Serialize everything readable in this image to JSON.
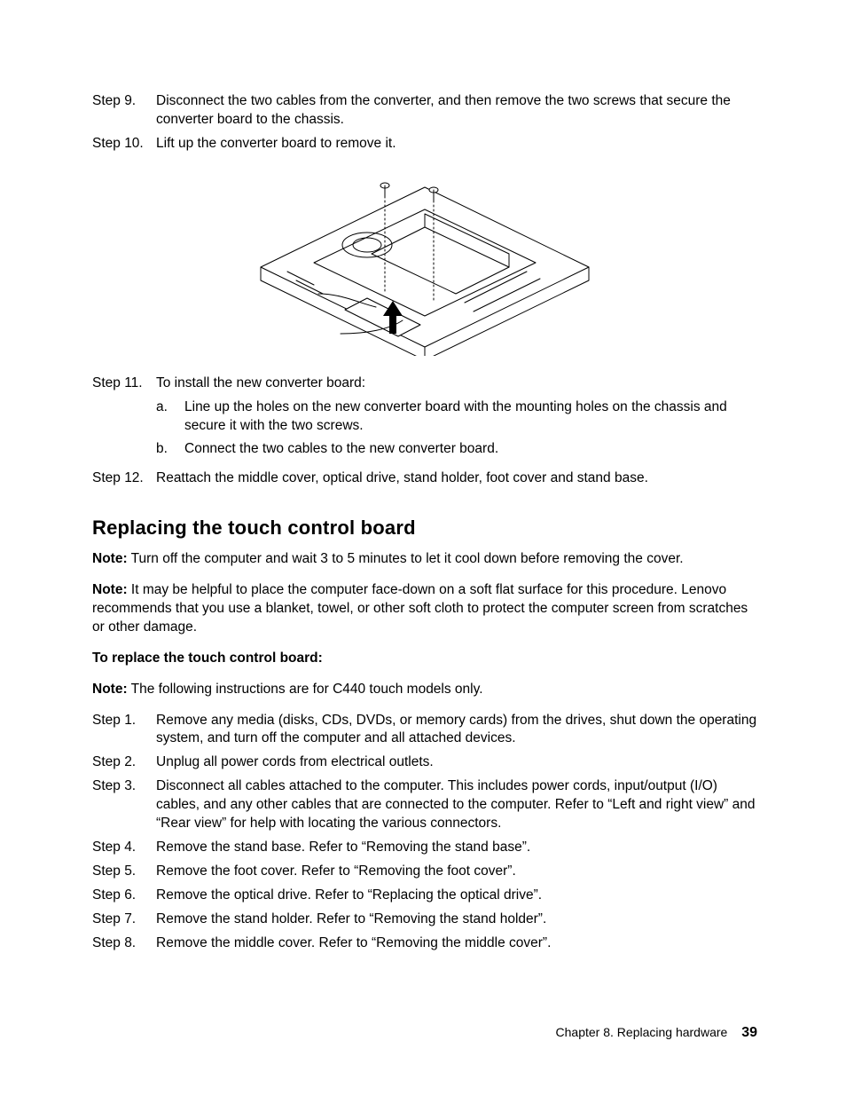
{
  "topSteps": [
    {
      "label": "Step 9.",
      "text": "Disconnect the two cables from the converter, and then remove the two screws that secure the converter board to the chassis."
    },
    {
      "label": "Step 10.",
      "text": "Lift up the converter board to remove it."
    }
  ],
  "step11": {
    "label": "Step 11.",
    "text": "To install the new converter board:",
    "subs": [
      {
        "label": "a.",
        "text": "Line up the holes on the new converter board with the mounting holes on the chassis and secure it with the two screws."
      },
      {
        "label": "b.",
        "text": "Connect the two cables to the new converter board."
      }
    ]
  },
  "step12": {
    "label": "Step 12.",
    "text": "Reattach the middle cover, optical drive, stand holder, foot cover and stand base."
  },
  "heading": "Replacing the touch control board",
  "note1_label": "Note:",
  "note1_text": " Turn off the computer and wait 3 to 5 minutes to let it cool down before removing the cover.",
  "note2_label": "Note:",
  "note2_text": " It may be helpful to place the computer face-down on a soft flat surface for this procedure. Lenovo recommends that you use a blanket, towel, or other soft cloth to protect the computer screen from scratches or other damage.",
  "sub_heading": "To replace the touch control board:",
  "note3_label": "Note:",
  "note3_text": " The following instructions are for C440 touch models only.",
  "bottomSteps": [
    {
      "label": "Step 1.",
      "text": "Remove any media (disks, CDs, DVDs, or memory cards) from the drives, shut down the operating system, and turn off the computer and all attached devices."
    },
    {
      "label": "Step 2.",
      "text": "Unplug all power cords from electrical outlets."
    },
    {
      "label": "Step 3.",
      "text": "Disconnect all cables attached to the computer. This includes power cords, input/output (I/O) cables, and any other cables that are connected to the computer. Refer to “Left and right view” and “Rear view” for help with locating the various connectors."
    },
    {
      "label": "Step 4.",
      "text": "Remove the stand base. Refer to “Removing the stand base”."
    },
    {
      "label": "Step 5.",
      "text": "Remove the foot cover. Refer to “Removing the foot cover”."
    },
    {
      "label": "Step 6.",
      "text": "Remove the optical drive. Refer to “Replacing the optical drive”."
    },
    {
      "label": "Step 7.",
      "text": "Remove the stand holder. Refer to “Removing the stand holder”."
    },
    {
      "label": "Step 8.",
      "text": "Remove the middle cover. Refer to “Removing the middle cover”."
    }
  ],
  "footer_chapter": "Chapter 8. Replacing hardware",
  "footer_page": "39"
}
